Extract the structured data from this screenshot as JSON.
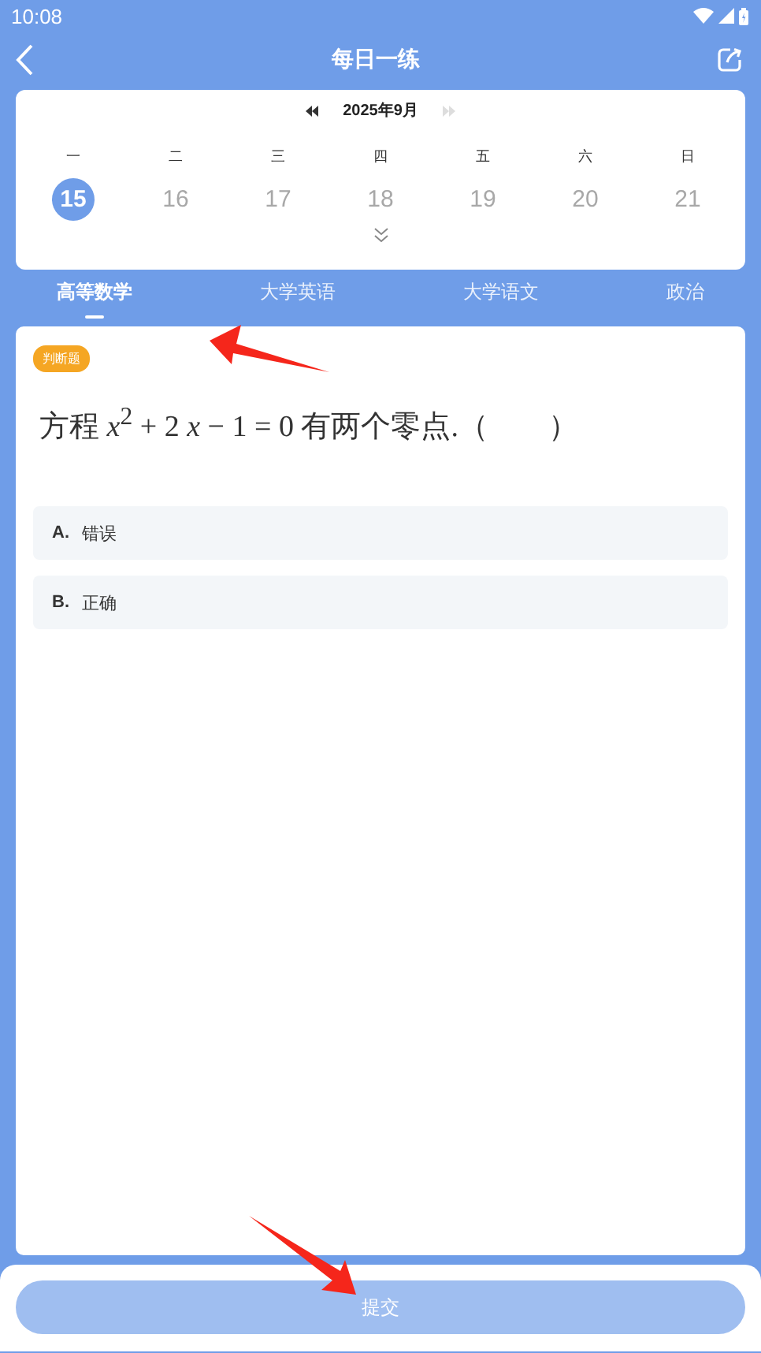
{
  "status_bar": {
    "time": "10:08"
  },
  "header": {
    "title": "每日一练"
  },
  "calendar": {
    "month": "2025年9月",
    "prev_disabled": false,
    "next_disabled": true,
    "weekdays": [
      "一",
      "二",
      "三",
      "四",
      "五",
      "六",
      "日"
    ],
    "days": [
      {
        "label": "15",
        "selected": true,
        "disabled": false
      },
      {
        "label": "16",
        "selected": false,
        "disabled": true
      },
      {
        "label": "17",
        "selected": false,
        "disabled": true
      },
      {
        "label": "18",
        "selected": false,
        "disabled": true
      },
      {
        "label": "19",
        "selected": false,
        "disabled": true
      },
      {
        "label": "20",
        "selected": false,
        "disabled": true
      },
      {
        "label": "21",
        "selected": false,
        "disabled": true
      }
    ]
  },
  "tabs": [
    {
      "label": "高等数学",
      "selected": true
    },
    {
      "label": "大学英语",
      "selected": false
    },
    {
      "label": "大学语文",
      "selected": false
    },
    {
      "label": "政治",
      "selected": false
    }
  ],
  "question": {
    "type": "判断题",
    "stem": "方程 *x*$^{2}$ + 2 *x* − 1 = 0 有两个零点.（　　）",
    "options": [
      {
        "letter": "A.",
        "text": "错误",
        "selected": false
      },
      {
        "letter": "B.",
        "text": "正确",
        "selected": false
      }
    ]
  },
  "submit": {
    "label": "提交",
    "disabled": true
  },
  "annotations": [
    {
      "kind": "arrow"
    },
    {
      "kind": "arrow"
    }
  ]
}
